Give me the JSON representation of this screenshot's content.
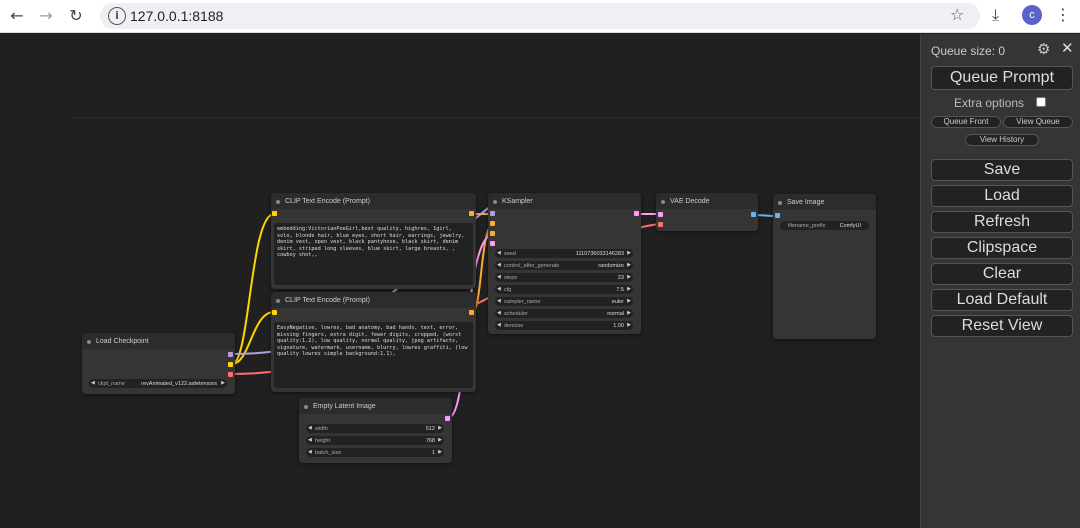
{
  "browser": {
    "url": "127.0.0.1:8188",
    "back_icon": "arrow-left-icon",
    "forward_icon": "arrow-right-icon",
    "reload_icon": "reload-icon",
    "avatar_letter": "c"
  },
  "sidebar": {
    "queue_size": "Queue size: 0",
    "queue_prompt": "Queue Prompt",
    "extra_options": "Extra options",
    "queue_front": "Queue Front",
    "view_queue": "View Queue",
    "view_history": "View History",
    "buttons": [
      "Save",
      "Load",
      "Refresh",
      "Clipspace",
      "Clear",
      "Load Default",
      "Reset View"
    ]
  },
  "nodes": {
    "clip_pos": {
      "title": "CLIP Text Encode (Prompt)",
      "text": "embedding:VictorianPoeGirl,best quality, highres, 1girl, solo, blonde hair, blue eyes, short hair, earrings, jewelry, denim vest, open vest, black pantyhose, black skirt, denim skirt, striped long sleeves, blue skirt, large breasts, , cowboy shot,,"
    },
    "clip_neg": {
      "title": "CLIP Text Encode (Prompt)",
      "text": "EasyNegative, lowres, bad anatomy, bad hands, text, error, missing fingers, extra digit, fewer digits, cropped, (worst quality:1.2), low quality, normal quality, jpeg artifacts, signature, watermark, username, blurry, lowres graffiti, (low quality lowres simple background:1.1),"
    },
    "ksampler": {
      "title": "KSampler",
      "widgets": [
        {
          "label": "seed",
          "value": "1110736033146283"
        },
        {
          "label": "control_after_generate",
          "value": "randomize"
        },
        {
          "label": "steps",
          "value": "23"
        },
        {
          "label": "cfg",
          "value": "7.5"
        },
        {
          "label": "sampler_name",
          "value": "euler"
        },
        {
          "label": "scheduler",
          "value": "normal"
        },
        {
          "label": "denoise",
          "value": "1.00"
        }
      ]
    },
    "vae_decode": {
      "title": "VAE Decode"
    },
    "save_image": {
      "title": "Save Image",
      "widget": {
        "label": "filename_prefix",
        "value": "ComfyUI"
      }
    },
    "load_checkpoint": {
      "title": "Load Checkpoint",
      "widget": {
        "label": "ckpt_name",
        "value": "revAnimated_v122.safetensors"
      }
    },
    "empty_latent": {
      "title": "Empty Latent Image",
      "widgets": [
        {
          "label": "width",
          "value": "512"
        },
        {
          "label": "height",
          "value": "768"
        },
        {
          "label": "batch_size",
          "value": "1"
        }
      ]
    }
  },
  "colors": {
    "clip_slot": "#ffd500",
    "cond_slot": "#ffa931",
    "model_slot": "#b39ddb",
    "latent_slot": "#ff9cf9",
    "vae_slot": "#ff6e6e",
    "image_slot": "#64b5f6"
  }
}
